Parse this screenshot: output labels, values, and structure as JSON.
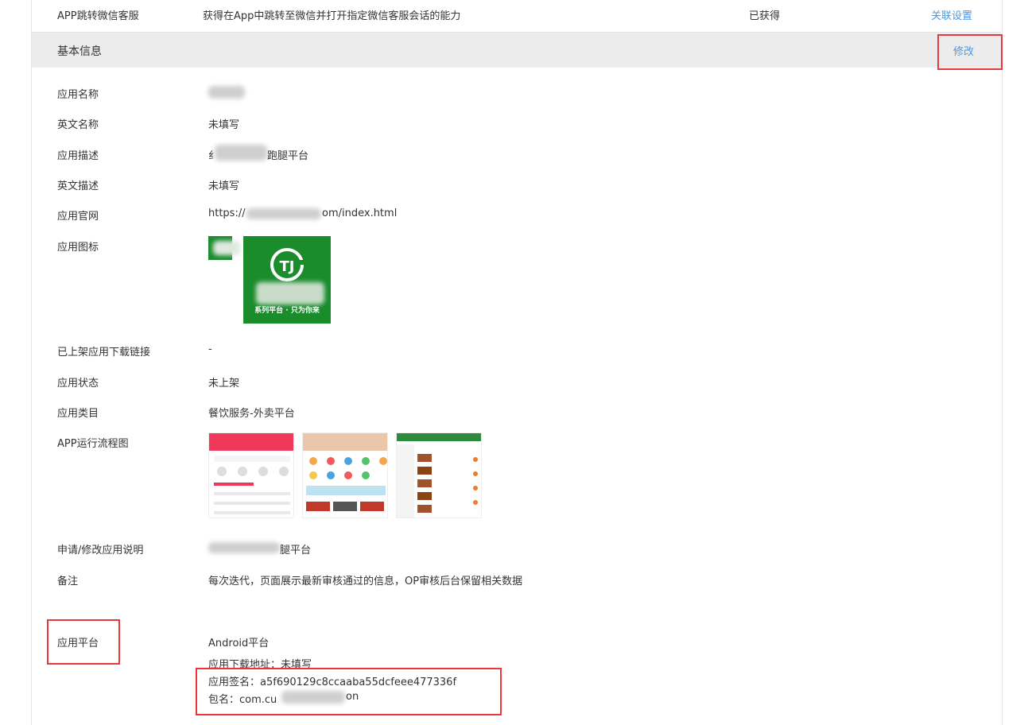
{
  "top_row": {
    "name": "APP跳转微信客服",
    "desc": "获得在App中跳转至微信并打开指定微信客服会话的能力",
    "status": "已获得",
    "action": "关联设置"
  },
  "section": {
    "title": "基本信息",
    "edit_label": "修改"
  },
  "fields": {
    "app_name": {
      "label": "应用名称",
      "value": ""
    },
    "en_name": {
      "label": "英文名称",
      "value": "未填写"
    },
    "app_desc": {
      "label": "应用描述",
      "value_prefix": "纟",
      "value_suffix": "跑腿平台"
    },
    "en_desc": {
      "label": "英文描述",
      "value": "未填写"
    },
    "website": {
      "label": "应用官网",
      "value_prefix": "https://",
      "value_suffix": "om/index.html"
    },
    "icon": {
      "label": "应用图标",
      "icon_text": "系列平台 · 只为你来"
    },
    "download_link": {
      "label": "已上架应用下载链接",
      "value": "-"
    },
    "status": {
      "label": "应用状态",
      "value": "未上架"
    },
    "category": {
      "label": "应用类目",
      "value": "餐饮服务-外卖平台"
    },
    "flow": {
      "label": "APP运行流程图"
    },
    "apply_note": {
      "label": "申请/修改应用说明",
      "value_suffix": "腿平台"
    },
    "remark": {
      "label": "备注",
      "value": "每次迭代，页面展示最新审核通过的信息，OP审核后台保留相关数据"
    },
    "platform": {
      "label": "应用平台",
      "value": "Android平台",
      "download": "应用下载地址：未填写",
      "signature": "应用签名：a5f690129c8ccaaba55dcfeee477336f",
      "package_prefix": "包名：com.cu",
      "package_suffix": "on"
    }
  },
  "colors": {
    "link": "#459ae9",
    "highlight": "#e5393b",
    "header_bg": "#ececec",
    "icon_green": "#1a8c2c"
  }
}
